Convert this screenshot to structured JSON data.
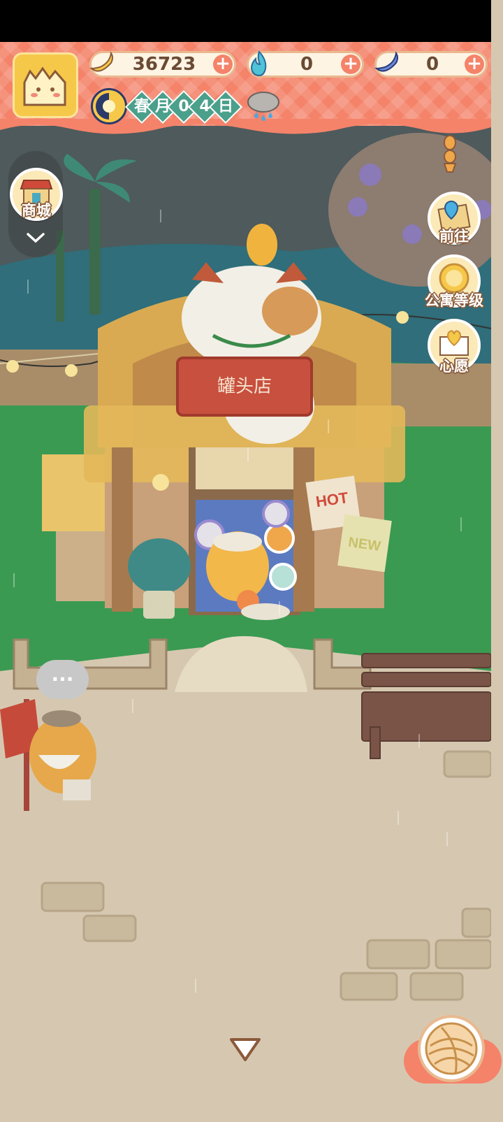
{
  "header": {
    "currencies": [
      {
        "name": "banana-coins",
        "value": "36723"
      },
      {
        "name": "blue-flame",
        "value": "0"
      },
      {
        "name": "blue-banana",
        "value": "0"
      }
    ],
    "date": {
      "season": "春",
      "month_label": "月",
      "day_digits": [
        "0",
        "4"
      ],
      "day_label": "日"
    },
    "weather": "rain-cloud-icon"
  },
  "left_menu": {
    "shop_label": "商城"
  },
  "right_menu": {
    "goto_label": "前往",
    "apartment_level_label": "公寓等级",
    "wish_label": "心愿"
  },
  "shop": {
    "sign": "罐头店",
    "poster_hot": "HOT",
    "poster_new": "NEW"
  },
  "npc": {
    "speech": "···"
  },
  "colors": {
    "accent": "#f4836a",
    "grass": "#3a9a52",
    "ground": "#d6c8b0"
  }
}
